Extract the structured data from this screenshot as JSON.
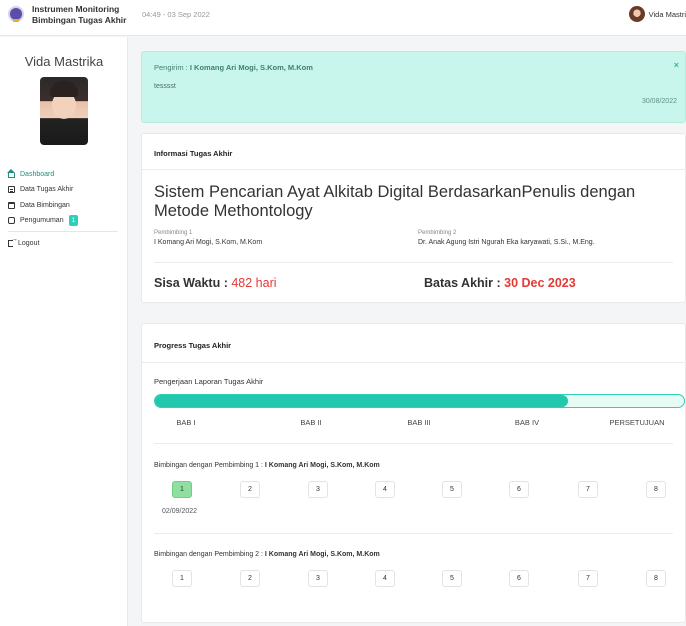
{
  "header": {
    "app_title_line1": "Instrumen Monitoring",
    "app_title_line2": "Bimbingan Tugas Akhir",
    "datetime": "04:49 - 03 Sep 2022",
    "user_name": "Vida Mastri"
  },
  "sidebar": {
    "profile_name": "Vida Mastrika",
    "items": [
      {
        "label": "Dashboard",
        "icon": "home-icon",
        "active": true
      },
      {
        "label": "Data Tugas Akhir",
        "icon": "document-icon"
      },
      {
        "label": "Data Bimbingan",
        "icon": "calendar-icon"
      },
      {
        "label": "Pengumuman",
        "icon": "bell-icon",
        "badge": "1"
      }
    ],
    "logout_label": "Logout"
  },
  "alert": {
    "sender_prefix": "Pengirim : ",
    "sender_name": "I Komang Ari Mogi, S.Kom, M.Kom",
    "message": "tesssst",
    "date": "30/08/2022",
    "close": "×"
  },
  "info": {
    "header": "Informasi Tugas Akhir",
    "title": "Sistem Pencarian Ayat Alkitab Digital BerdasarkanPenulis dengan Metode Methontology",
    "pembimbing1_label": "Pembimbing 1",
    "pembimbing1_name": "I Komang Ari Mogi, S.Kom, M.Kom",
    "pembimbing2_label": "Pembimbing 2",
    "pembimbing2_name": "Dr. Anak Agung Istri Ngurah Eka karyawati, S.Si., M.Eng.",
    "sisa_label": "Sisa Waktu : ",
    "sisa_value": "482 hari",
    "batas_label": "Batas Akhir : ",
    "batas_value": "30 Dec 2023"
  },
  "progress": {
    "header": "Progress Tugas Akhir",
    "section_label": "Pengerjaan Laporan Tugas Akhir",
    "percent": 78,
    "stages": [
      "BAB I",
      "BAB II",
      "BAB III",
      "BAB IV",
      "PERSETUJUAN"
    ],
    "bimbingan1_prefix": "Bimbingan dengan Pembimbing 1 : ",
    "bimbingan1_name": "I Komang Ari Mogi, S.Kom, M.Kom",
    "bimbingan1_steps": [
      "1",
      "2",
      "3",
      "4",
      "5",
      "6",
      "7",
      "8"
    ],
    "bimbingan1_done": 1,
    "bimbingan1_date": "02/09/2022",
    "bimbingan2_prefix": "Bimbingan dengan Pembimbing 2 : ",
    "bimbingan2_name": "I Komang Ari Mogi, S.Kom, M.Kom",
    "bimbingan2_steps": [
      "1",
      "2",
      "3",
      "4",
      "5",
      "6",
      "7",
      "8"
    ]
  },
  "colors": {
    "accent": "#22c8ad",
    "alert_bg": "#c9f6ec",
    "danger": "#e53935"
  }
}
